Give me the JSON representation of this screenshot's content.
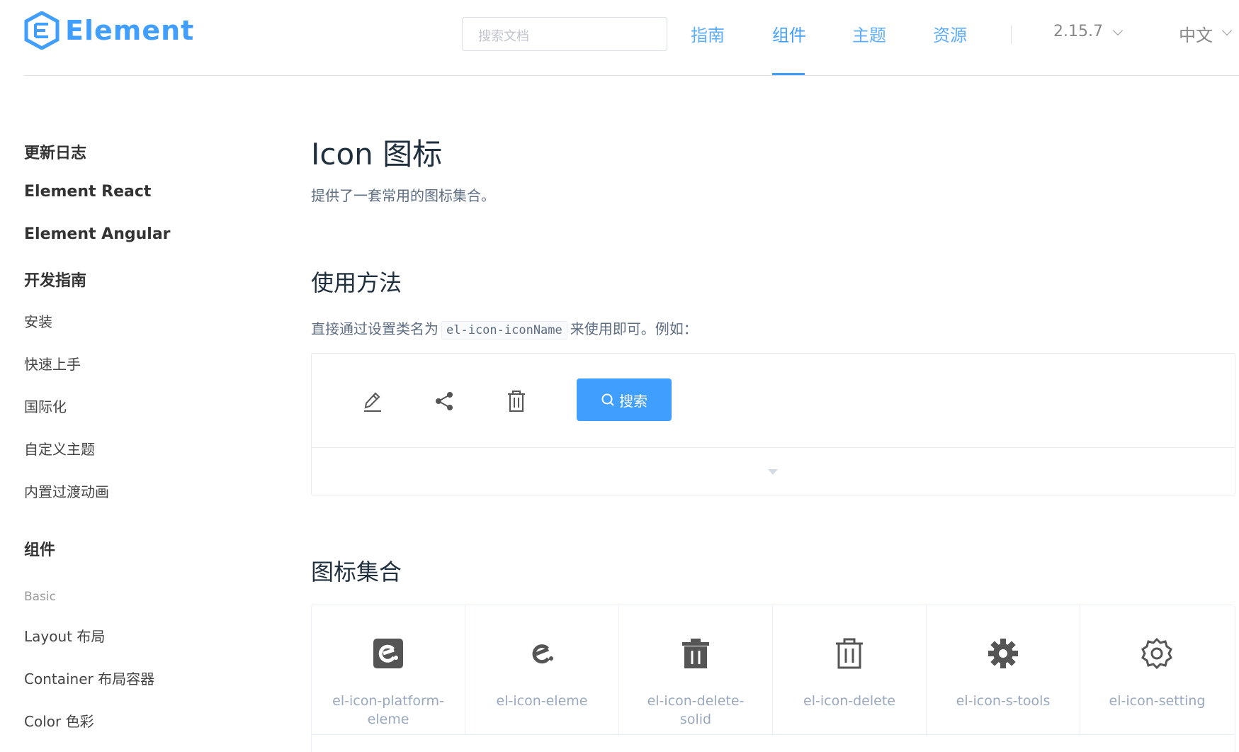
{
  "header": {
    "logo_text": "Element",
    "search_placeholder": "搜索文档",
    "nav": [
      "指南",
      "组件",
      "主题",
      "资源"
    ],
    "active_nav": "组件",
    "version": "2.15.7",
    "language": "中文",
    "accent_color": "#409eff"
  },
  "sidebar": {
    "top_links": [
      "更新日志",
      "Element React",
      "Element Angular"
    ],
    "dev_guide": {
      "title": "开发指南",
      "items": [
        "安装",
        "快速上手",
        "国际化",
        "自定义主题",
        "内置过渡动画"
      ]
    },
    "components": {
      "title": "组件",
      "group": "Basic",
      "items": [
        "Layout 布局",
        "Container 布局容器",
        "Color 色彩"
      ]
    }
  },
  "main": {
    "title": "Icon 图标",
    "description": "提供了一套常用的图标集合。",
    "usage_title": "使用方法",
    "usage_text_before": "直接通过设置类名为",
    "usage_code": "el-icon-iconName",
    "usage_text_after": "来使用即可。例如：",
    "demo": {
      "icons": [
        "edit-icon",
        "share-icon",
        "delete-icon"
      ],
      "button_label": "搜索"
    },
    "icons_title": "图标集合",
    "icons": [
      {
        "name": "el-icon-platform-eleme",
        "icon": "platform-eleme-icon"
      },
      {
        "name": "el-icon-eleme",
        "icon": "eleme-icon"
      },
      {
        "name": "el-icon-delete-solid",
        "icon": "delete-solid-icon"
      },
      {
        "name": "el-icon-delete",
        "icon": "delete-icon"
      },
      {
        "name": "el-icon-s-tools",
        "icon": "s-tools-icon"
      },
      {
        "name": "el-icon-setting",
        "icon": "setting-icon"
      }
    ]
  }
}
